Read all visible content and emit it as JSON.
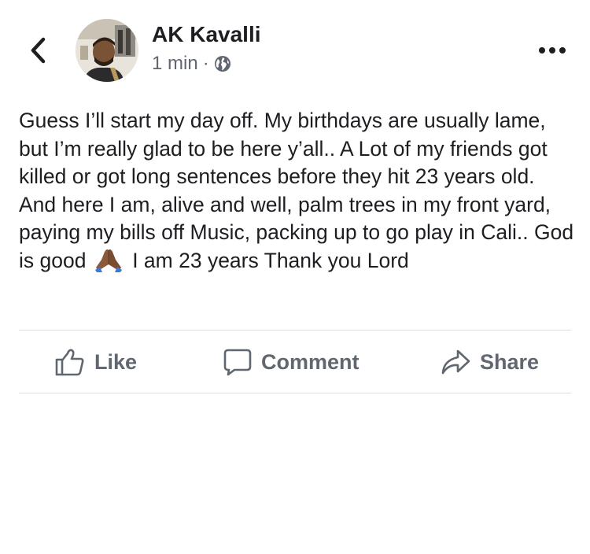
{
  "post": {
    "author": "AK Kavalli",
    "time": "1 min",
    "separator": "·",
    "privacy_icon": "globe-icon",
    "text_paragraph_1": "Guess I’ll start my day off. My birthdays are usually lame, but I’m really glad to be here y’all.. A Lot of my friends got killed or got long sentences before they hit 23 years old.",
    "text_paragraph_2_before_emoji": "And here I am, alive and well, palm trees in my front yard, paying my bills off Music, packing up to go play in Cali.. God is good",
    "emoji": "folded-hands-emoji",
    "text_paragraph_2_after_emoji": "I am 23 years Thank you Lord"
  },
  "actions": {
    "like_label": "Like",
    "comment_label": "Comment",
    "share_label": "Share"
  },
  "colors": {
    "text_primary": "#1c1e21",
    "text_secondary": "#606770",
    "divider": "#dadde1"
  }
}
